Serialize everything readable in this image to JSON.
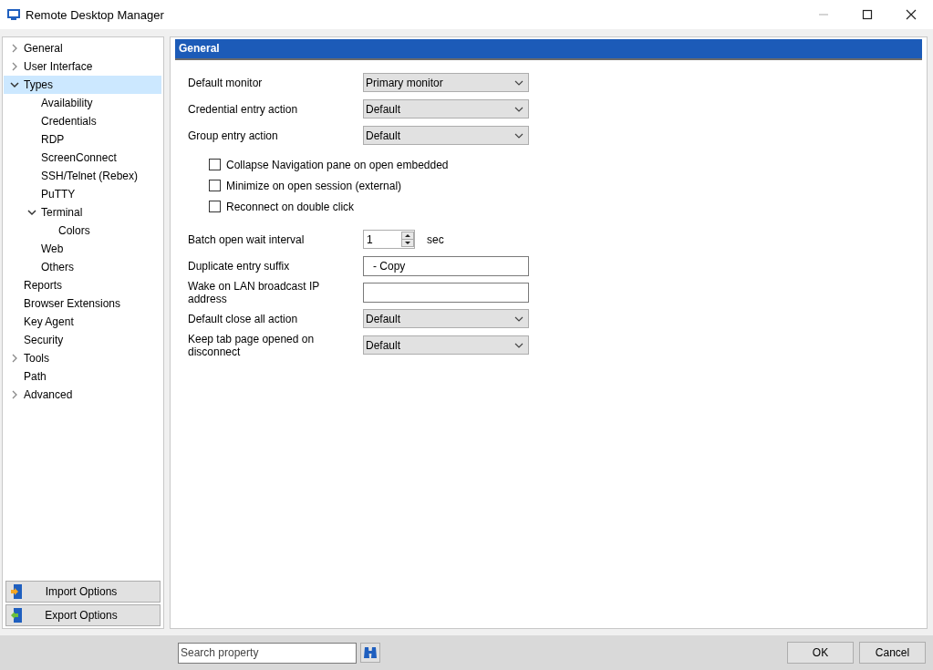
{
  "window": {
    "title": "Remote Desktop Manager"
  },
  "sidebar": {
    "tree": [
      {
        "label": "General",
        "kind": "group",
        "expanded": false,
        "selected": false
      },
      {
        "label": "User Interface",
        "kind": "group",
        "expanded": false,
        "selected": false
      },
      {
        "label": "Types",
        "kind": "group",
        "expanded": true,
        "selected": true,
        "children": [
          {
            "label": "Availability",
            "kind": "page",
            "selected": false
          },
          {
            "label": "Credentials",
            "kind": "page",
            "selected": false
          },
          {
            "label": "RDP",
            "kind": "page",
            "selected": false
          },
          {
            "label": "ScreenConnect",
            "kind": "page",
            "selected": false
          },
          {
            "label": "SSH/Telnet (Rebex)",
            "kind": "page",
            "selected": false
          },
          {
            "label": "PuTTY",
            "kind": "page",
            "selected": false
          },
          {
            "label": "Terminal",
            "kind": "group",
            "expanded": true,
            "selected": false,
            "children": [
              {
                "label": "Colors",
                "kind": "page",
                "selected": false
              }
            ]
          },
          {
            "label": "Web",
            "kind": "page",
            "selected": false
          },
          {
            "label": "Others",
            "kind": "page",
            "selected": false
          }
        ]
      },
      {
        "label": "Reports",
        "kind": "page",
        "selected": false
      },
      {
        "label": "Browser Extensions",
        "kind": "page",
        "selected": false
      },
      {
        "label": "Key Agent",
        "kind": "page",
        "selected": false
      },
      {
        "label": "Security",
        "kind": "page",
        "selected": false
      },
      {
        "label": "Tools",
        "kind": "group",
        "expanded": false,
        "selected": false
      },
      {
        "label": "Path",
        "kind": "page",
        "selected": false
      },
      {
        "label": "Advanced",
        "kind": "group",
        "expanded": false,
        "selected": false
      }
    ],
    "buttons": [
      {
        "label": "Import Options",
        "kind": "import"
      },
      {
        "label": "Export Options",
        "kind": "export"
      }
    ]
  },
  "panel": {
    "header": "General",
    "settings": [
      {
        "kind": "dropdown",
        "label": "Default monitor",
        "value": "Primary monitor"
      },
      {
        "kind": "dropdown",
        "label": "Credential entry action",
        "value": "Default"
      },
      {
        "kind": "dropdown",
        "label": "Group entry action",
        "value": "Default"
      },
      {
        "kind": "checkbox",
        "label": "Collapse Navigation pane on open embedded",
        "checked": false
      },
      {
        "kind": "checkbox",
        "label": "Minimize on open session (external)",
        "checked": false
      },
      {
        "kind": "checkbox",
        "label": "Reconnect on double click",
        "checked": false
      },
      {
        "kind": "spinner",
        "label": "Batch open wait interval",
        "value": "1",
        "unit": "sec"
      },
      {
        "kind": "text",
        "label": "Duplicate entry suffix",
        "value": "- Copy"
      },
      {
        "kind": "text",
        "label": "Wake on LAN broadcast IP address"
      },
      {
        "kind": "dropdown",
        "label": "Default close all action",
        "value": "Default"
      },
      {
        "kind": "dropdown",
        "label": "Keep tab page opened on disconnect",
        "value": "Default"
      }
    ]
  },
  "footer": {
    "search": {
      "placeholder": "Search property"
    },
    "buttons": [
      "OK",
      "Cancel"
    ]
  }
}
